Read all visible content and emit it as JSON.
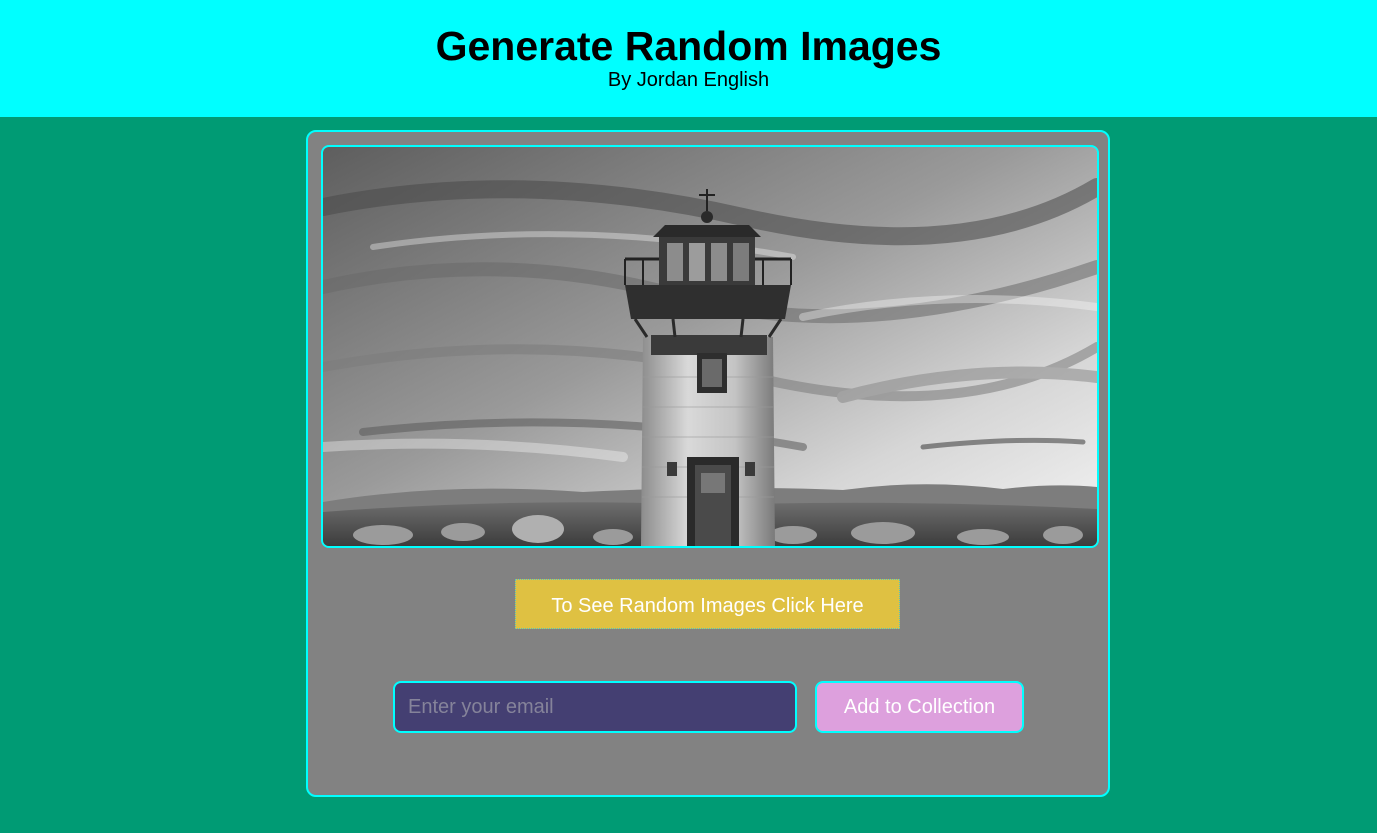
{
  "header": {
    "title": "Generate Random Images",
    "subtitle": "By Jordan English"
  },
  "image": {
    "alt": "Black and white lighthouse under a cloudy sky"
  },
  "actions": {
    "random_button_label": "To See Random Images Click Here"
  },
  "collection_form": {
    "email_placeholder": "Enter your email",
    "email_value": "",
    "add_button_label": "Add to Collection"
  },
  "colors": {
    "page_background": "#009b74",
    "header_background": "#00ffff",
    "card_background": "#828282",
    "accent_border": "#00ffff",
    "random_button": "#dfc142",
    "email_field": "#443f72",
    "add_button": "#dda0dd"
  }
}
